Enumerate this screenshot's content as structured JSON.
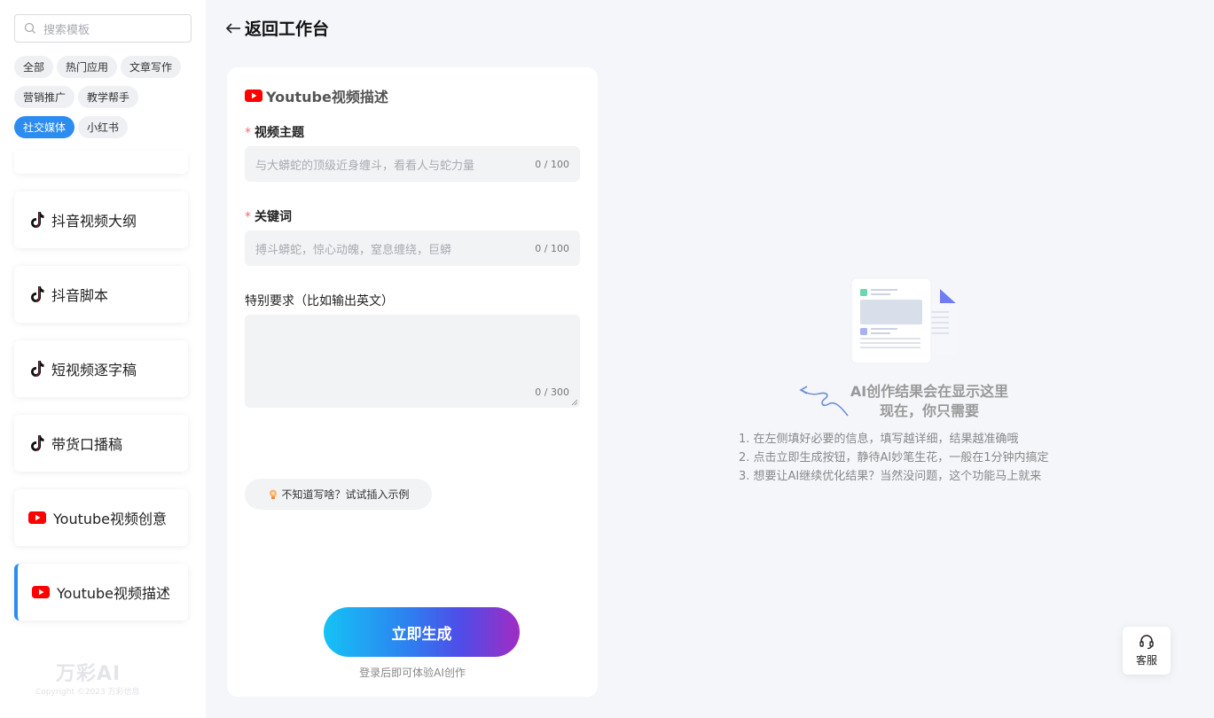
{
  "sidebar": {
    "search_placeholder": "搜索模板",
    "tags": [
      {
        "label": "全部",
        "active": false
      },
      {
        "label": "热门应用",
        "active": false
      },
      {
        "label": "文章写作",
        "active": false
      },
      {
        "label": "营销推广",
        "active": false
      },
      {
        "label": "教学帮手",
        "active": false
      },
      {
        "label": "社交媒体",
        "active": true
      },
      {
        "label": "小红书",
        "active": false
      }
    ],
    "items": [
      {
        "label": "抖音视频大纲",
        "icon": "tiktok-icon"
      },
      {
        "label": "抖音脚本",
        "icon": "tiktok-icon"
      },
      {
        "label": "短视频逐字稿",
        "icon": "tiktok-icon"
      },
      {
        "label": "带货口播稿",
        "icon": "tiktok-icon"
      },
      {
        "label": "Youtube视频创意",
        "icon": "youtube-icon"
      },
      {
        "label": "Youtube视频描述",
        "icon": "youtube-icon",
        "active": true
      }
    ],
    "brand": "万彩AI",
    "copyright": "Copyright ©2023 万彩信息"
  },
  "header": {
    "back_label": "返回工作台"
  },
  "form": {
    "title": "Youtube视频描述",
    "required_mark": "*",
    "fields": {
      "topic": {
        "label": "视频主题",
        "placeholder": "与大蟒蛇的顶级近身缠斗，看看人与蛇力量",
        "count": "0 / 100"
      },
      "keywords": {
        "label": "关键词",
        "placeholder": "搏斗蟒蛇，惊心动魄，窒息缠绕，巨蟒",
        "count": "0 / 100"
      },
      "special": {
        "label": "特别要求（比如输出英文）",
        "count": "0 / 300"
      }
    },
    "hint_label": "不知道写啥？试试插入示例",
    "generate_label": "立即生成",
    "login_tip": "登录后即可体验AI创作"
  },
  "result": {
    "title_line1": "AI创作结果会在显示这里",
    "title_line2": "现在，你只需要",
    "tips": [
      "1. 在左侧填好必要的信息，填写越详细，结果越准确哦",
      "2. 点击立即生成按钮，静待AI妙笔生花，一般在1分钟内搞定",
      "3. 想要让AI继续优化结果？当然没问题，这个功能马上就来"
    ]
  },
  "support": {
    "label": "客服"
  },
  "colors": {
    "accent": "#2d8cf0",
    "youtube": "#ff0000",
    "required": "#f56c6c"
  }
}
